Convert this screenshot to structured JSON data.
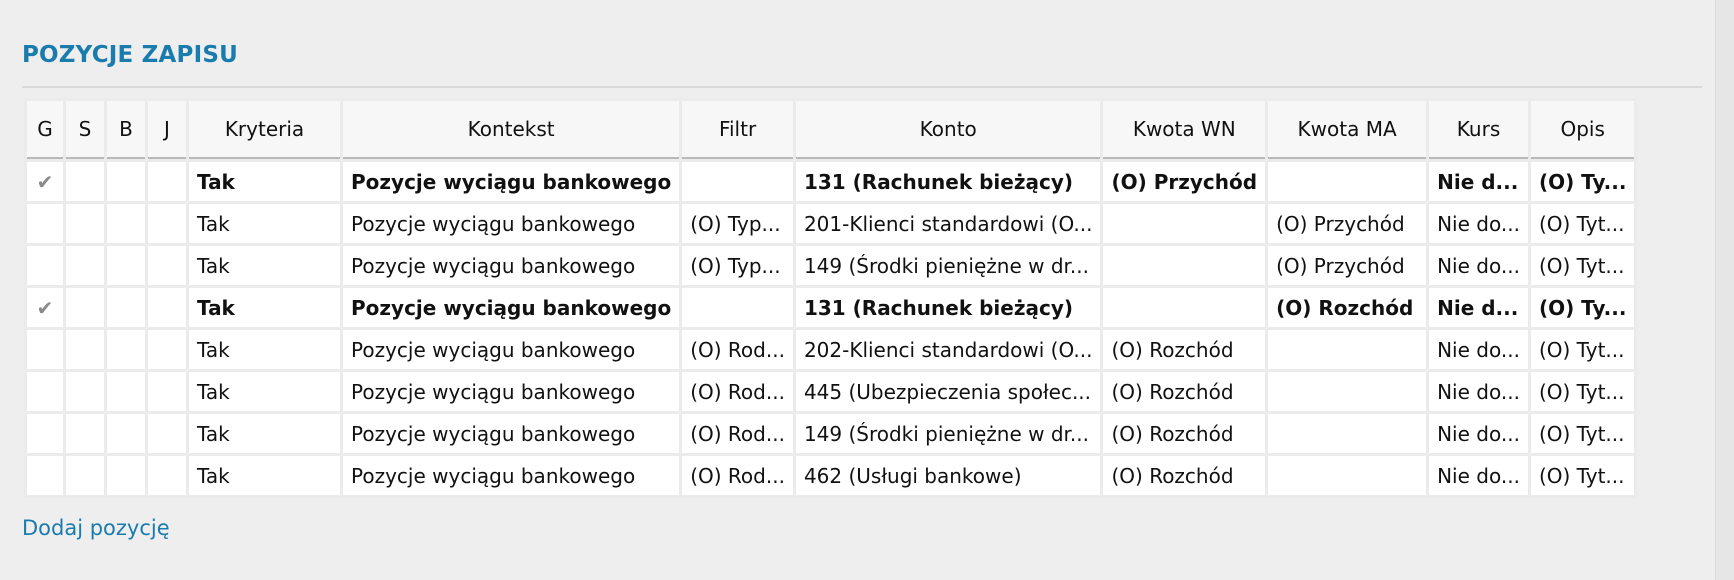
{
  "section": {
    "title": "POZYCJE ZAPISU",
    "add_link": "Dodaj pozycję"
  },
  "columns": [
    {
      "key": "g",
      "label": "G"
    },
    {
      "key": "s",
      "label": "S"
    },
    {
      "key": "b",
      "label": "B"
    },
    {
      "key": "j",
      "label": "J"
    },
    {
      "key": "kryteria",
      "label": "Kryteria"
    },
    {
      "key": "kontekst",
      "label": "Kontekst"
    },
    {
      "key": "filtr",
      "label": "Filtr"
    },
    {
      "key": "konto",
      "label": "Konto"
    },
    {
      "key": "kwota_wn",
      "label": "Kwota WN"
    },
    {
      "key": "kwota_ma",
      "label": "Kwota MA"
    },
    {
      "key": "kurs",
      "label": "Kurs"
    },
    {
      "key": "opis",
      "label": "Opis"
    }
  ],
  "rows": [
    {
      "bold": true,
      "g": "✔",
      "s": "",
      "b": "",
      "j": "",
      "kryteria": "Tak",
      "kontekst": "Pozycje wyciągu bankowego",
      "filtr": "",
      "konto": "131 (Rachunek bieżący)",
      "kwota_wn": "(O) Przychód",
      "kwota_ma": "",
      "kurs": "Nie d...",
      "opis": "(O) Ty..."
    },
    {
      "bold": false,
      "g": "",
      "s": "",
      "b": "",
      "j": "",
      "kryteria": "Tak",
      "kontekst": "Pozycje wyciągu bankowego",
      "filtr": "(O) Typ...",
      "konto": "201-Klienci standardowi (O...",
      "kwota_wn": "",
      "kwota_ma": "(O) Przychód",
      "kurs": "Nie do...",
      "opis": "(O) Tyt..."
    },
    {
      "bold": false,
      "g": "",
      "s": "",
      "b": "",
      "j": "",
      "kryteria": "Tak",
      "kontekst": "Pozycje wyciągu bankowego",
      "filtr": "(O) Typ...",
      "konto": "149 (Środki pieniężne w dr...",
      "kwota_wn": "",
      "kwota_ma": "(O) Przychód",
      "kurs": "Nie do...",
      "opis": "(O) Tyt..."
    },
    {
      "bold": true,
      "g": "✔",
      "s": "",
      "b": "",
      "j": "",
      "kryteria": "Tak",
      "kontekst": "Pozycje wyciągu bankowego",
      "filtr": "",
      "konto": "131 (Rachunek bieżący)",
      "kwota_wn": "",
      "kwota_ma": "(O) Rozchód",
      "kurs": "Nie d...",
      "opis": "(O) Ty..."
    },
    {
      "bold": false,
      "g": "",
      "s": "",
      "b": "",
      "j": "",
      "kryteria": "Tak",
      "kontekst": "Pozycje wyciągu bankowego",
      "filtr": "(O) Rod...",
      "konto": "202-Klienci standardowi (O...",
      "kwota_wn": "(O) Rozchód",
      "kwota_ma": "",
      "kurs": "Nie do...",
      "opis": "(O) Tyt..."
    },
    {
      "bold": false,
      "g": "",
      "s": "",
      "b": "",
      "j": "",
      "kryteria": "Tak",
      "kontekst": "Pozycje wyciągu bankowego",
      "filtr": "(O) Rod...",
      "konto": "445 (Ubezpieczenia społec...",
      "kwota_wn": "(O) Rozchód",
      "kwota_ma": "",
      "kurs": "Nie do...",
      "opis": "(O) Tyt..."
    },
    {
      "bold": false,
      "g": "",
      "s": "",
      "b": "",
      "j": "",
      "kryteria": "Tak",
      "kontekst": "Pozycje wyciągu bankowego",
      "filtr": "(O) Rod...",
      "konto": "149 (Środki pieniężne w dr...",
      "kwota_wn": "(O) Rozchód",
      "kwota_ma": "",
      "kurs": "Nie do...",
      "opis": "(O) Tyt..."
    },
    {
      "bold": false,
      "g": "",
      "s": "",
      "b": "",
      "j": "",
      "kryteria": "Tak",
      "kontekst": "Pozycje wyciągu bankowego",
      "filtr": "(O) Rod...",
      "konto": "462 (Usługi bankowe)",
      "kwota_wn": "(O) Rozchód",
      "kwota_ma": "",
      "kurs": "Nie do...",
      "opis": "(O) Tyt..."
    }
  ],
  "colors": {
    "accent": "#1a7bad",
    "check": "#8a8a8a"
  },
  "icons": {
    "check": "checkmark-icon"
  }
}
